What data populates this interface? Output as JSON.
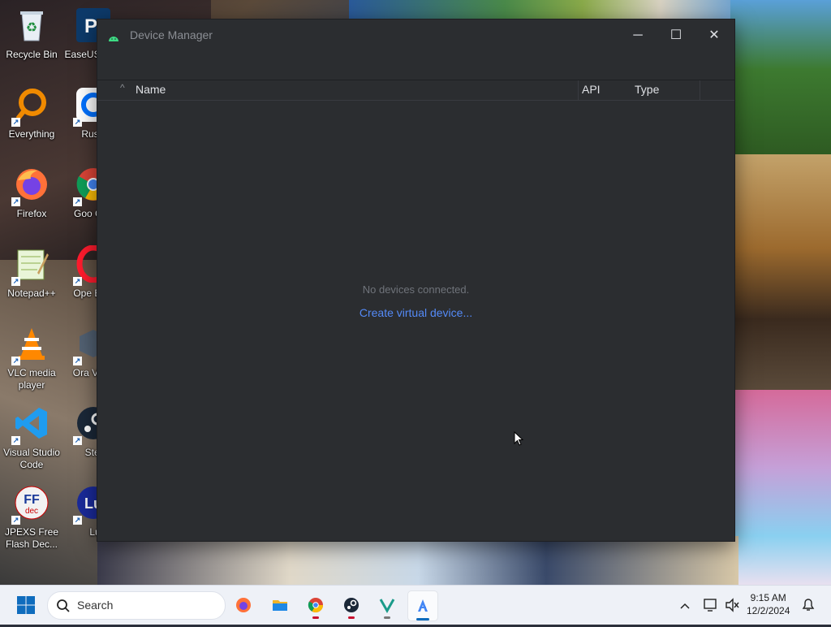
{
  "desktop": {
    "icons": [
      {
        "label": "Recycle Bin"
      },
      {
        "label": "EaseUS PCTr"
      },
      {
        "label": "Everything"
      },
      {
        "label": "RustD"
      },
      {
        "label": "Firefox"
      },
      {
        "label": "Goo Chro"
      },
      {
        "label": "Notepad++"
      },
      {
        "label": "Ope Brow"
      },
      {
        "label": "VLC media player"
      },
      {
        "label": "Ora Virtua"
      },
      {
        "label": "Visual Studio Code"
      },
      {
        "label": "Stea"
      },
      {
        "label": "JPEXS Free Flash Dec..."
      },
      {
        "label": "Lu"
      }
    ]
  },
  "window": {
    "title": "Device Manager",
    "controls": {
      "minimize": "─",
      "maximize": "☐",
      "close": "✕"
    },
    "table": {
      "sort_indicator": "^",
      "columns": [
        "Name",
        "API",
        "Type"
      ]
    },
    "empty_message": "No devices connected.",
    "create_link": "Create virtual device..."
  },
  "taskbar": {
    "search_placeholder": "Search",
    "apps": [
      "firefox-icon",
      "file-explorer-icon",
      "chrome-icon",
      "steam-icon",
      "visual-studio-icon",
      "android-studio-icon"
    ],
    "clock": {
      "time": "9:15 AM",
      "date": "12/2/2024"
    }
  },
  "colors": {
    "window_bg": "#2b2d30",
    "link": "#548af7",
    "muted_text": "#6f737a",
    "taskbar_bg": "#eef1f7"
  }
}
